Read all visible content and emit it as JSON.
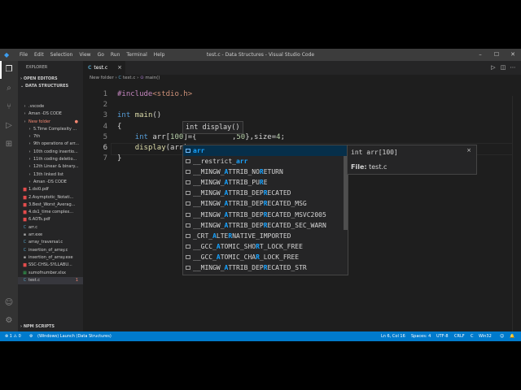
{
  "titlebar": {
    "menu": [
      "File",
      "Edit",
      "Selection",
      "View",
      "Go",
      "Run",
      "Terminal",
      "Help"
    ],
    "title": "test.c - Data Structures - Visual Studio Code",
    "controls": [
      "–",
      "☐",
      "✕"
    ]
  },
  "activity": [
    "files-icon",
    "search-icon",
    "source-control-icon",
    "run-debug-icon",
    "extensions-icon",
    "account-icon",
    "settings-gear-icon"
  ],
  "explorer": {
    "header": "EXPLORER",
    "open_editors": "OPEN EDITORS",
    "workspace": "DATA STRUCTURES",
    "items": [
      {
        "label": ".vscode",
        "type": "folder",
        "indent": 1
      },
      {
        "label": "Aman -DS CODE",
        "type": "folder",
        "indent": 1
      },
      {
        "label": "New folder",
        "type": "folder",
        "indent": 1,
        "status": "red"
      },
      {
        "label": "5.Time Complexity ...",
        "type": "folder",
        "indent": 2
      },
      {
        "label": "7th",
        "type": "folder",
        "indent": 2
      },
      {
        "label": "9th operations of arr...",
        "type": "folder",
        "indent": 2
      },
      {
        "label": "10th coding insertio...",
        "type": "folder",
        "indent": 2
      },
      {
        "label": "11th coding deletio...",
        "type": "folder",
        "indent": 2
      },
      {
        "label": "12th Linear & binary...",
        "type": "folder",
        "indent": 2
      },
      {
        "label": "13th linked list",
        "type": "folder",
        "indent": 2
      },
      {
        "label": "Aman -DS CODE",
        "type": "folder",
        "indent": 2
      },
      {
        "label": "1.dsi0.pdf",
        "type": "pdf",
        "indent": 1
      },
      {
        "label": "2.Asymptotic_Notati...",
        "type": "pdf",
        "indent": 1
      },
      {
        "label": "3.Best_Worst_Averag...",
        "type": "pdf",
        "indent": 1
      },
      {
        "label": "4.ds1_time complex...",
        "type": "pdf",
        "indent": 1
      },
      {
        "label": "6.ADTs.pdf",
        "type": "pdf",
        "indent": 1
      },
      {
        "label": "arr.c",
        "type": "c",
        "indent": 1
      },
      {
        "label": "arr.exe",
        "type": "exe",
        "indent": 1
      },
      {
        "label": "array_traversal.c",
        "type": "c",
        "indent": 1
      },
      {
        "label": "insertion_of_array.c",
        "type": "c",
        "indent": 1
      },
      {
        "label": "insertion_of_array.exe",
        "type": "exe",
        "indent": 1
      },
      {
        "label": "SSC-CHSL-SYLLABU...",
        "type": "pdf",
        "indent": 1
      },
      {
        "label": "sumofnumber.xlsx",
        "type": "xlsx",
        "indent": 1
      },
      {
        "label": "test.c",
        "type": "c",
        "indent": 1,
        "selected": true,
        "badge": "1"
      }
    ],
    "npm": "NPM SCRIPTS"
  },
  "editor": {
    "tab": {
      "icon": "C",
      "label": "test.c",
      "close": "×"
    },
    "breadcrumb": [
      "New folder",
      "test.c",
      "main()"
    ],
    "lines": [
      {
        "n": "1",
        "tokens": [
          {
            "c": "pp",
            "t": "#include"
          },
          {
            "c": "str",
            "t": "<stdio.h>"
          }
        ]
      },
      {
        "n": "2",
        "tokens": []
      },
      {
        "n": "3",
        "tokens": [
          {
            "c": "kw",
            "t": "int"
          },
          {
            "c": "tx",
            "t": " "
          },
          {
            "c": "fn",
            "t": "main"
          },
          {
            "c": "tx",
            "t": "()"
          }
        ]
      },
      {
        "n": "4",
        "tokens": [
          {
            "c": "tx",
            "t": "{"
          }
        ]
      },
      {
        "n": "5",
        "tokens": [
          {
            "c": "tx",
            "t": "    "
          },
          {
            "c": "kw",
            "t": "int"
          },
          {
            "c": "tx",
            "t": " arr["
          },
          {
            "c": "num",
            "t": "100"
          },
          {
            "c": "tx",
            "t": "]="
          },
          {
            "c": "tx",
            "t": "{        "
          },
          {
            "c": "tx",
            "t": ","
          },
          {
            "c": "num",
            "t": "50"
          },
          {
            "c": "tx",
            "t": "},size="
          },
          {
            "c": "num",
            "t": "4"
          },
          {
            "c": "tx",
            "t": ";"
          }
        ]
      },
      {
        "n": "6",
        "tokens": [
          {
            "c": "tx",
            "t": "    "
          },
          {
            "c": "fn",
            "t": "display"
          },
          {
            "c": "tx",
            "t": "(arr)"
          }
        ],
        "current": true
      },
      {
        "n": "7",
        "tokens": [
          {
            "c": "tx",
            "t": "}"
          }
        ]
      }
    ],
    "signature_hint": "int display()",
    "suggestions": [
      {
        "pre": "",
        "m": "arr",
        "post": "",
        "kind": "var"
      },
      {
        "pre": "__restrict_",
        "m": "arr",
        "post": "",
        "kind": "text"
      },
      {
        "pre": "__MINGW_",
        "m": "A",
        "post": "TTRIB_NO",
        "m2": "R",
        "post2": "ETURN",
        "kind": "text"
      },
      {
        "pre": "__MINGW_",
        "m": "A",
        "post": "TTRIB_PU",
        "m2": "R",
        "post2": "E",
        "kind": "text"
      },
      {
        "pre": "__MINGW_",
        "m": "A",
        "post": "TTRIB_DEP",
        "m2": "R",
        "post2": "ECATED",
        "kind": "text"
      },
      {
        "pre": "__MINGW_",
        "m": "A",
        "post": "TTRIB_DEP",
        "m2": "R",
        "post2": "ECATED_MSG",
        "kind": "text"
      },
      {
        "pre": "__MINGW_",
        "m": "A",
        "post": "TTRIB_DEP",
        "m2": "R",
        "post2": "ECATED_MSVC2005",
        "kind": "text"
      },
      {
        "pre": "__MINGW_",
        "m": "A",
        "post": "TTRIB_DEP",
        "m2": "R",
        "post2": "ECATED_SEC_WARN",
        "kind": "text"
      },
      {
        "pre": "_CRT_",
        "m": "A",
        "post": "LTE",
        "m2": "R",
        "post2": "NATIVE_IMPORTED",
        "kind": "text"
      },
      {
        "pre": "__GCC_",
        "m": "A",
        "post": "TOMIC_SHO",
        "m2": "R",
        "post2": "T_LOCK_FREE",
        "kind": "text"
      },
      {
        "pre": "__GCC_",
        "m": "A",
        "post": "TOMIC_CHA",
        "m2": "R",
        "post2": "_LOCK_FREE",
        "kind": "text"
      },
      {
        "pre": "__MINGW_",
        "m": "A",
        "post": "TTRIB_DEP",
        "m2": "R",
        "post2": "ECATED_STR",
        "kind": "text"
      }
    ],
    "details": {
      "signature": "int arr[100]",
      "file_label": "File:",
      "file_value": "test.c",
      "close": "×"
    }
  },
  "statusbar": {
    "left": [
      "⊗ 1 ⚠ 0",
      "⚙",
      "(Windows) Launch (Data Structures)"
    ],
    "right": [
      "Ln 6, Col 16",
      "Spaces: 4",
      "UTF-8",
      "CRLF",
      "C",
      "Win32"
    ]
  },
  "colors": {
    "accent": "#007acc",
    "match": "#18a3ff",
    "selection": "#062f4a"
  }
}
